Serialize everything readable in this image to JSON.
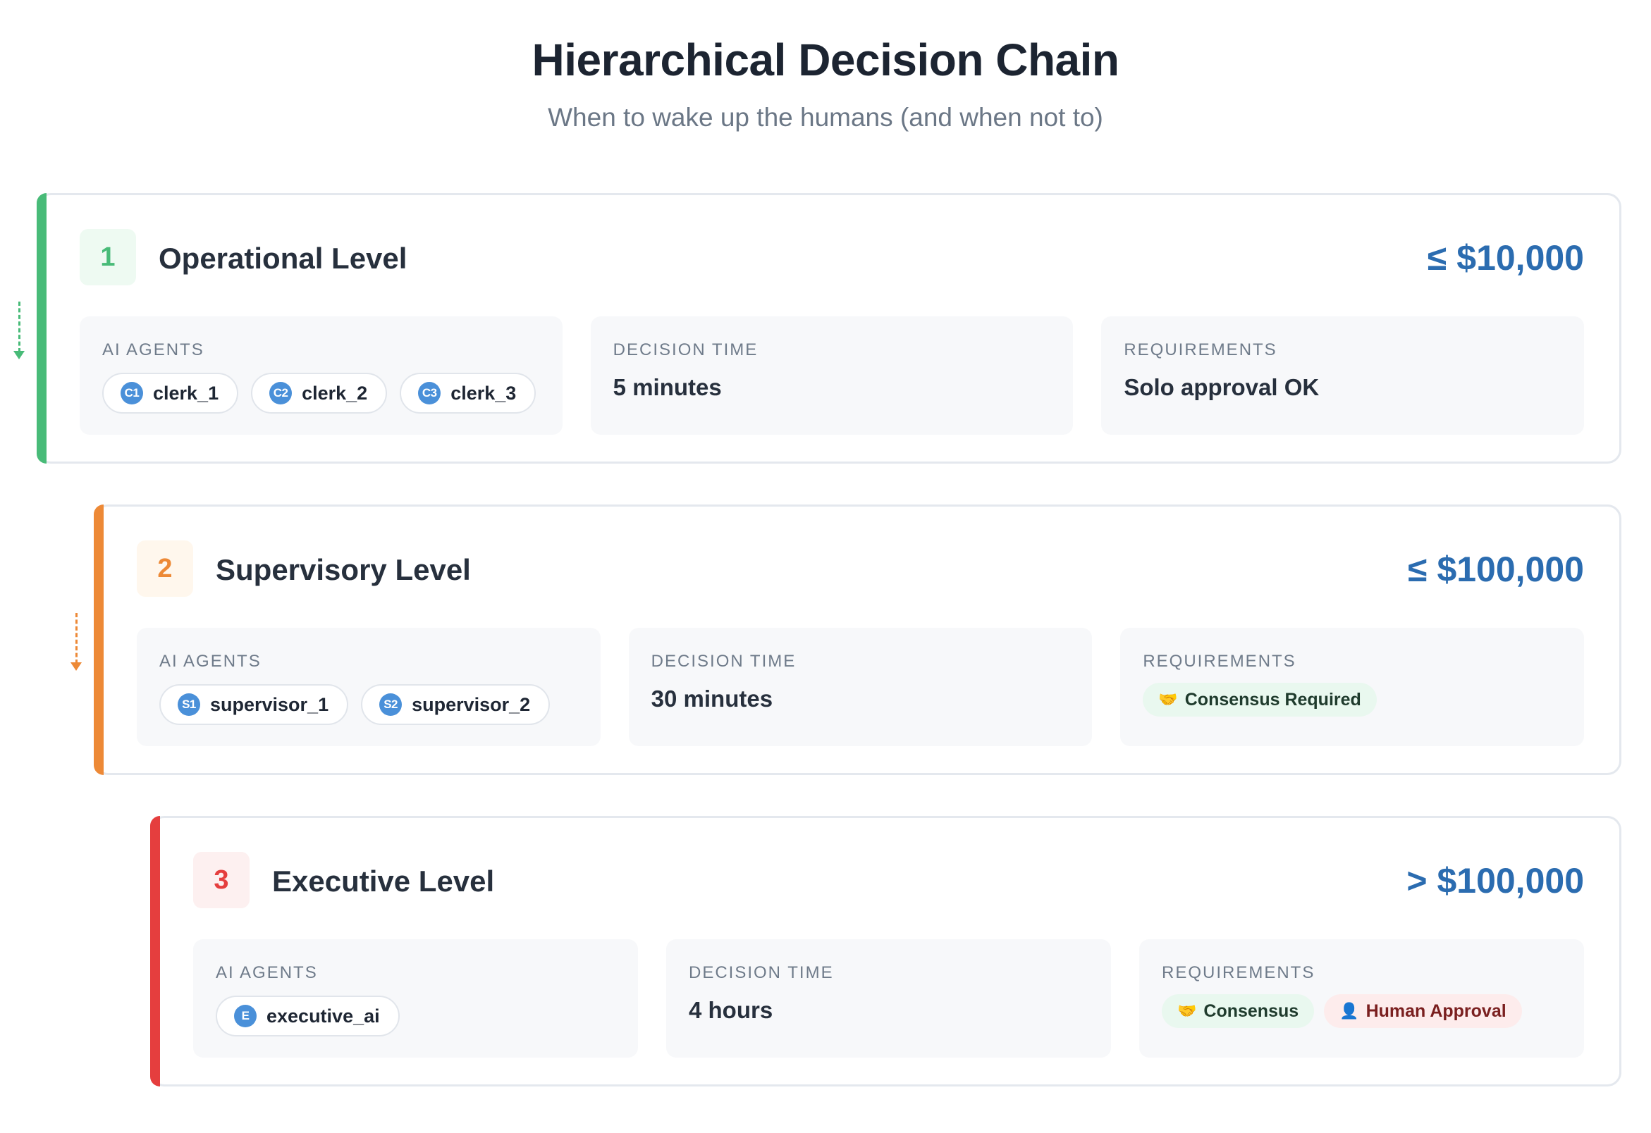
{
  "header": {
    "title": "Hierarchical Decision Chain",
    "subtitle": "When to wake up the humans (and when not to)"
  },
  "labels": {
    "agents": "AI AGENTS",
    "decision_time": "DECISION TIME",
    "requirements": "REQUIREMENTS"
  },
  "colors": {
    "operational": "#48bb78",
    "supervisory": "#ed8936",
    "executive": "#e53e3e",
    "threshold": "#2b6cb0",
    "agent_icon": "#4a90d9"
  },
  "levels": [
    {
      "number": "1",
      "name": "Operational Level",
      "threshold": "≤ $10,000",
      "agents": [
        {
          "icon": "C1",
          "name": "clerk_1"
        },
        {
          "icon": "C2",
          "name": "clerk_2"
        },
        {
          "icon": "C3",
          "name": "clerk_3"
        }
      ],
      "decision_time": "5 minutes",
      "requirements_text": "Solo approval OK"
    },
    {
      "number": "2",
      "name": "Supervisory Level",
      "threshold": "≤ $100,000",
      "agents": [
        {
          "icon": "S1",
          "name": "supervisor_1"
        },
        {
          "icon": "S2",
          "name": "supervisor_2"
        }
      ],
      "decision_time": "30 minutes",
      "requirements_tags": [
        {
          "icon": "handshake-icon",
          "label": "Consensus Required"
        }
      ]
    },
    {
      "number": "3",
      "name": "Executive Level",
      "threshold": "> $100,000",
      "agents": [
        {
          "icon": "E",
          "name": "executive_ai"
        }
      ],
      "decision_time": "4 hours",
      "requirements_tags": [
        {
          "icon": "handshake-icon",
          "label": "Consensus"
        },
        {
          "icon": "person-icon",
          "label": "Human Approval"
        }
      ]
    }
  ]
}
